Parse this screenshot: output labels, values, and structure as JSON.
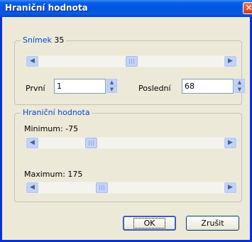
{
  "window": {
    "title": "Hraniční hodnota",
    "close_glyph": "✕"
  },
  "frame_group": {
    "legend": "Snímek",
    "current": "35",
    "scroll_position": 0.5,
    "first_label": "První",
    "first_value": "1",
    "last_label": "Poslední",
    "last_value": "68"
  },
  "threshold_group": {
    "legend": "Hraniční hodnota",
    "minimum_label": "Minimum:",
    "minimum_value": "-75",
    "minimum_position": 0.27,
    "maximum_label": "Maximum:",
    "maximum_value": "175",
    "maximum_position": 0.33
  },
  "buttons": {
    "ok": "OK",
    "cancel": "Zrušit"
  },
  "icons": {
    "scroll_left": "◀",
    "scroll_right": "▶",
    "spin_up": "▲",
    "spin_down": "▼"
  }
}
